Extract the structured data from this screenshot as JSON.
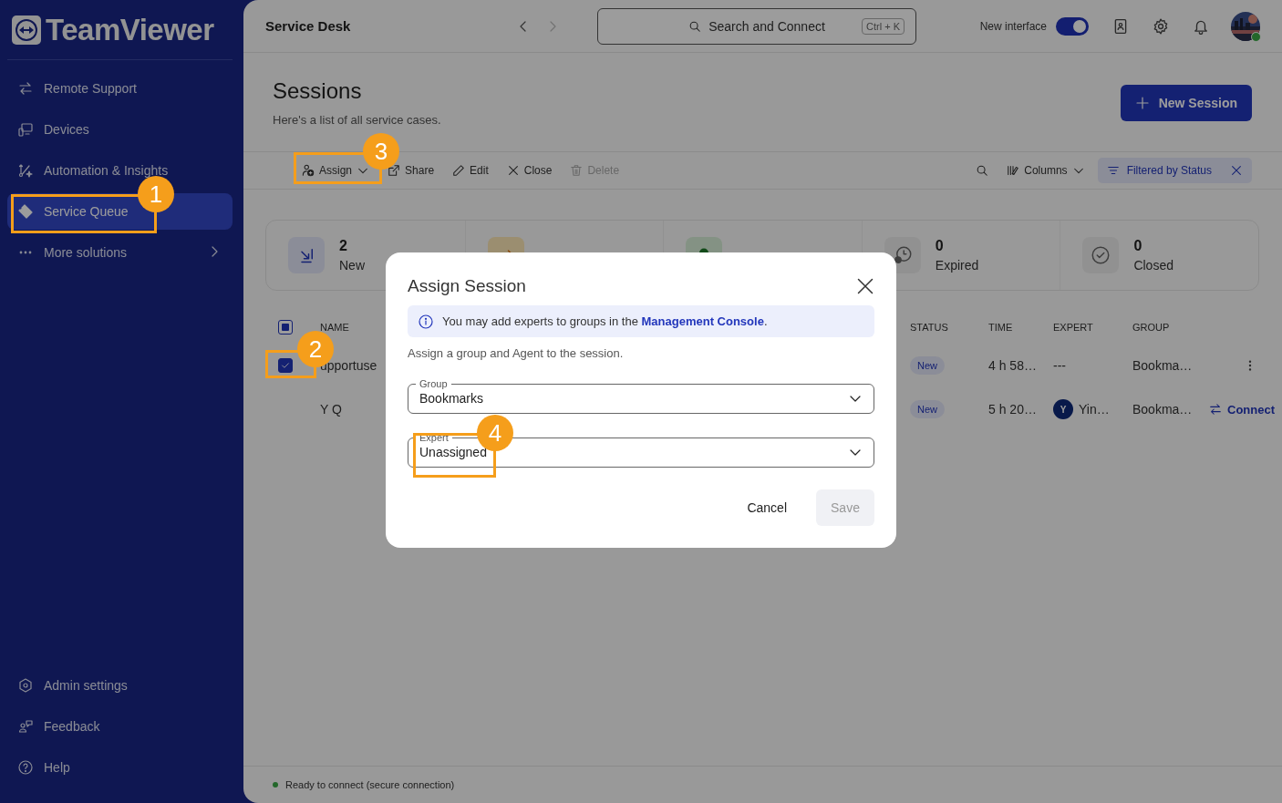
{
  "sidebar": {
    "logo": "TeamViewer",
    "items": [
      {
        "label": "Remote Support",
        "kind": "arrows",
        "selected": false
      },
      {
        "label": "Devices",
        "kind": "devices",
        "selected": false
      },
      {
        "label": "Automation & Insights",
        "kind": "automation",
        "selected": false
      },
      {
        "label": "Service Queue",
        "kind": "ticket",
        "selected": true
      },
      {
        "label": "More solutions",
        "kind": "more",
        "selected": false
      }
    ],
    "footer_items": [
      {
        "label": "Admin settings",
        "kind": "admin"
      },
      {
        "label": "Feedback",
        "kind": "feedback"
      },
      {
        "label": "Help",
        "kind": "help"
      }
    ]
  },
  "topbar": {
    "title": "Service Desk",
    "search": {
      "placeholder": "Search and Connect",
      "shortcut": "Ctrl + K"
    },
    "toggle": {
      "label": "New interface",
      "on": true
    }
  },
  "page": {
    "title": "Sessions",
    "subtitle": "Here's a list of all service cases.",
    "new_button": "New Session"
  },
  "toolbar": {
    "actions": [
      {
        "label": "Assign",
        "kind": "assign",
        "disabled": false
      },
      {
        "label": "Share",
        "kind": "share",
        "disabled": false
      },
      {
        "label": "Edit",
        "kind": "edit",
        "disabled": false
      },
      {
        "label": "Close",
        "kind": "close",
        "disabled": false
      },
      {
        "label": "Delete",
        "kind": "delete",
        "disabled": true
      }
    ],
    "columns_button": "Columns",
    "filter_chip": "Filtered by Status"
  },
  "stats": [
    {
      "count": "2",
      "label": "New",
      "kind": "new"
    },
    {
      "kind": "forward"
    },
    {
      "kind": "dot"
    },
    {
      "count": "0",
      "label": "Expired",
      "kind": "expired"
    },
    {
      "count": "0",
      "label": "Closed",
      "kind": "closed"
    }
  ],
  "table": {
    "header_partial": true,
    "columns": [
      "NAME",
      "STATUS",
      "TIME",
      "EXPERT",
      "GROUP"
    ],
    "rows": [
      {
        "name": "upportuse",
        "selected": true,
        "status": "New",
        "time": "4 h 58…",
        "expert": {
          "kind": "none",
          "text": "---"
        },
        "group": "Bookma…",
        "action": {
          "kind": "menu"
        }
      },
      {
        "name": "Y Q",
        "selected": false,
        "status": "New",
        "time": "5 h 20…",
        "expert": {
          "kind": "avatar",
          "initial": "Y",
          "text": "Yin…"
        },
        "group": "Bookma…",
        "action": {
          "kind": "connect",
          "label": "Connect"
        }
      }
    ]
  },
  "dialog": {
    "title": "Assign Session",
    "info_text": "You may add experts to groups in the",
    "info_link": "Management Console",
    "info_end": ".",
    "description": "Assign a group and Agent to the session.",
    "fields": [
      {
        "label": "Group",
        "value": "Bookmarks"
      },
      {
        "label": "Expert",
        "value": "Unassigned"
      }
    ],
    "cancel": "Cancel",
    "save": {
      "label": "Save",
      "disabled": true
    }
  },
  "status_bar": {
    "text": "Ready to connect (secure connection)",
    "connected": true
  },
  "callouts": [
    "1",
    "2",
    "3",
    "4"
  ]
}
